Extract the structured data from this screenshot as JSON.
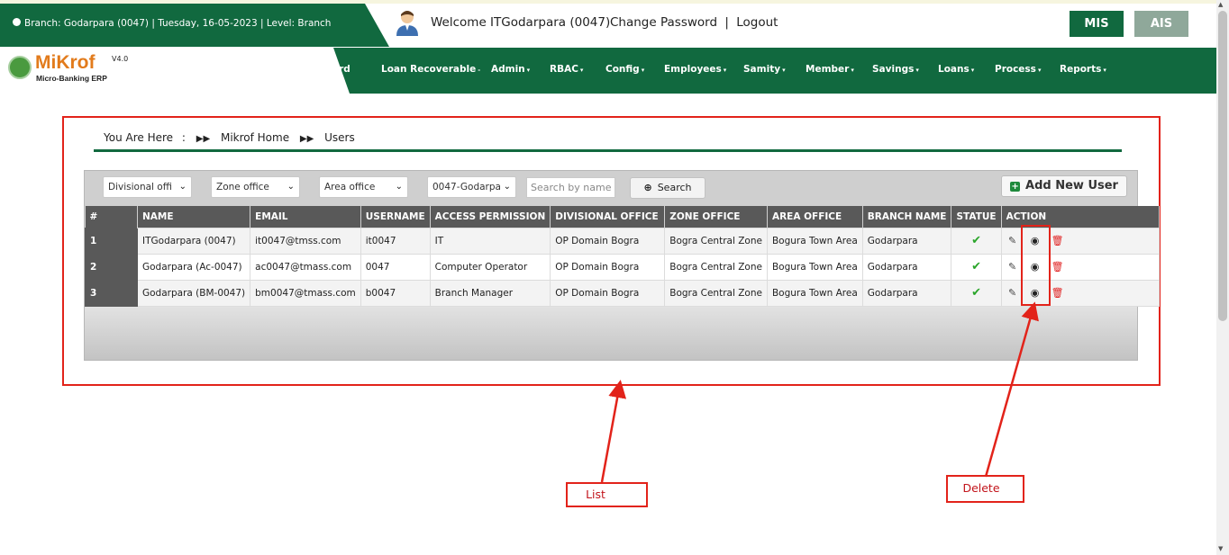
{
  "header": {
    "info": "Branch: Godarpara (0047) | Tuesday, 16-05-2023 | Level: Branch",
    "welcome": "Welcome ITGodarpara (0047)",
    "change_password": "Change Password",
    "separator": "|",
    "logout": "Logout",
    "mis_label": "MIS",
    "ais_label": "AIS"
  },
  "logo": {
    "name": "MiKrof",
    "version": "V4.0",
    "tagline": "Micro-Banking ERP"
  },
  "nav": {
    "items": [
      {
        "label": "ard",
        "caret": ""
      },
      {
        "label": "Loan Recoverable",
        "caret": "-"
      },
      {
        "label": "Admin",
        "caret": "▾"
      },
      {
        "label": "RBAC",
        "caret": "▾"
      },
      {
        "label": "Config",
        "caret": "▾"
      },
      {
        "label": "Employees",
        "caret": "▾"
      },
      {
        "label": "Samity",
        "caret": "▾"
      },
      {
        "label": "Member",
        "caret": "▾"
      },
      {
        "label": "Savings",
        "caret": "▾"
      },
      {
        "label": "Loans",
        "caret": "▾"
      },
      {
        "label": "Process",
        "caret": "▾"
      },
      {
        "label": "Reports",
        "caret": "▾"
      }
    ]
  },
  "breadcrumb": {
    "prefix": "You Are Here",
    "colon": ":",
    "home": "Mikrof Home",
    "current": "Users"
  },
  "filters": {
    "divisional": "Divisional offi",
    "zone": "Zone office",
    "area": "Area office",
    "branch": "0047-Godarpa",
    "search_placeholder": "Search by name",
    "search_button": "Search",
    "add_button": "Add New User"
  },
  "table": {
    "headers": [
      "#",
      "NAME",
      "EMAIL",
      "USERNAME",
      "ACCESS PERMISSION",
      "DIVISIONAL OFFICE",
      "ZONE OFFICE",
      "AREA OFFICE",
      "BRANCH NAME",
      "STATUE",
      "ACTION"
    ],
    "rows": [
      [
        "1",
        "ITGodarpara (0047)",
        "it0047@tmss.com",
        "it0047",
        "IT",
        "OP Domain Bogra",
        "Bogra Central Zone",
        "Bogura Town Area",
        "Godarpara"
      ],
      [
        "2",
        "Godarpara (Ac-0047)",
        "ac0047@tmass.com",
        "0047",
        "Computer Operator",
        "OP Domain Bogra",
        "Bogra Central Zone",
        "Bogura Town Area",
        "Godarpara"
      ],
      [
        "3",
        "Godarpara (BM-0047)",
        "bm0047@tmass.com",
        "b0047",
        "Branch Manager",
        "OP Domain Bogra",
        "Bogra Central Zone",
        "Bogura Town Area",
        "Godarpara"
      ]
    ]
  },
  "annotations": {
    "list_label": "List",
    "delete_label": "Delete",
    "color": "#e2231a"
  },
  "colors": {
    "brand_green": "#11693f",
    "header_gray": "#595959",
    "status_green": "#2aa52a",
    "delete_red": "#e02424"
  },
  "icons": {
    "status": "check-icon",
    "edit": "edit-icon",
    "view": "eye-icon",
    "delete": "trash-icon"
  }
}
